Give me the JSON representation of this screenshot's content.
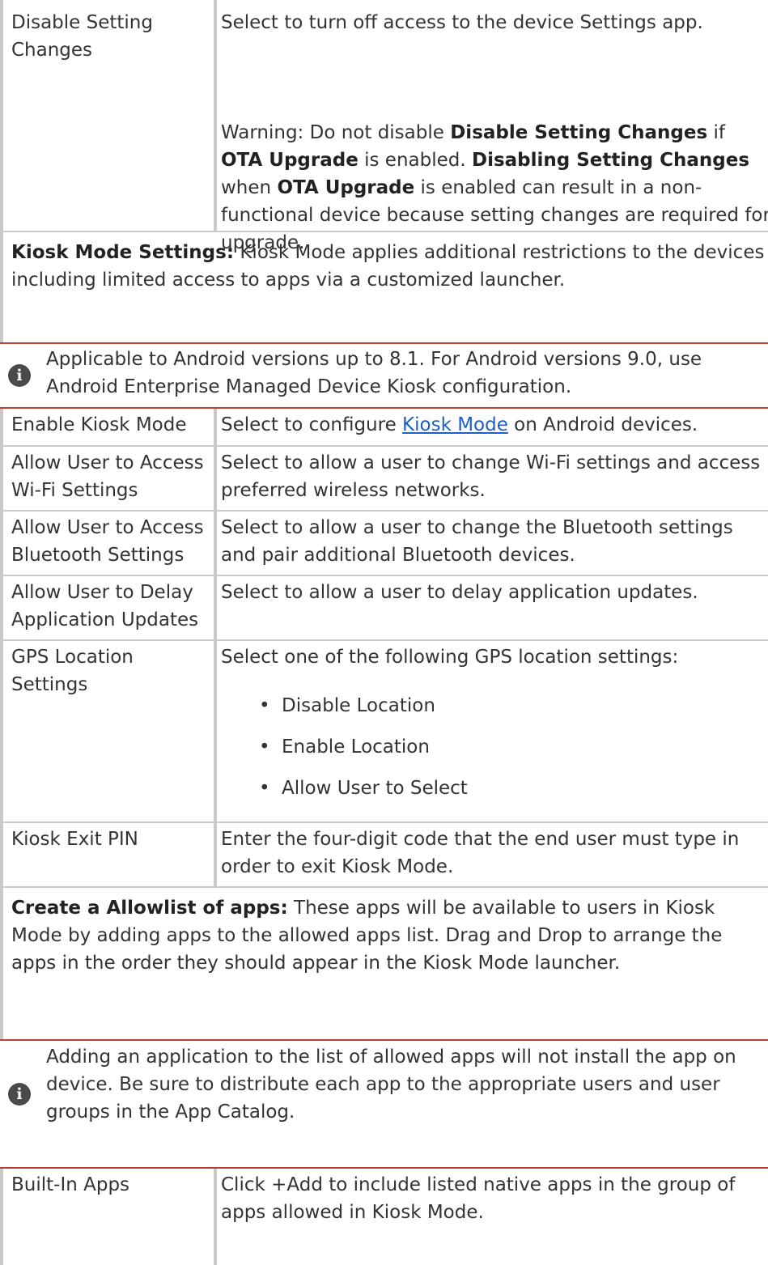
{
  "disable_setting": {
    "name": "Disable Setting Changes",
    "description": "Select to turn off access to the device Settings app.",
    "warning": {
      "prefix": "Warning: Do not disable ",
      "b1": "Disable Setting Changes",
      "t1": " if ",
      "b2": "OTA Upgrade",
      "t2": " is enabled. ",
      "b3": "Disabling Setting Changes",
      "t3": " when ",
      "b4": "OTA Upgrade",
      "t4": " is enabled can result in a non-functional device because setting changes are required for upgrade."
    }
  },
  "kiosk_section": {
    "heading": "Kiosk Mode Settings:",
    "text": " Kiosk Mode applies additional restrictions to the devices including limited access to apps via a customized launcher.",
    "note": "Applicable to Android versions up to 8.1. For Android versions 9.0, use Android Enterprise Managed Device Kiosk configuration."
  },
  "rows": {
    "enable_kiosk": {
      "name": "Enable Kiosk Mode",
      "desc_before": "Select to configure ",
      "link": "Kiosk Mode",
      "desc_after": " on Android devices."
    },
    "wifi": {
      "name": "Allow User to Access Wi-Fi Settings",
      "desc": "Select to allow a  user to change Wi-Fi settings and access preferred wireless networks."
    },
    "bluetooth": {
      "name": "Allow User to Access Bluetooth Settings",
      "desc": "Select to allow a user to change the Bluetooth settings and pair additional Bluetooth devices."
    },
    "delay_updates": {
      "name": "Allow User to Delay Application Updates",
      "desc": "Select to allow a user to delay application updates."
    },
    "gps": {
      "name": "GPS Location Settings",
      "desc": "Select one of the following GPS location settings:",
      "options": [
        "Disable Location",
        "Enable Location",
        "Allow User to Select"
      ]
    },
    "exit_pin": {
      "name": "Kiosk Exit PIN",
      "desc": "Enter the four-digit code that the end user must type in order to exit Kiosk Mode."
    }
  },
  "allowlist_section": {
    "heading": "Create a Allowlist of apps:",
    "text": " These apps will be available to users in Kiosk Mode by adding apps to the allowed apps list. Drag and Drop to arrange the apps in the order they should appear in the Kiosk Mode launcher.",
    "note": "Adding an application to the list of allowed apps will not install the app on device. Be sure to distribute each app to the appropriate users and user groups in the App Catalog."
  },
  "built_in": {
    "name": "Built-In Apps",
    "desc": "Click +Add to include listed native apps in the group of apps allowed in Kiosk Mode."
  },
  "icons": {
    "note": "info-icon",
    "bullet": "•"
  },
  "colors": {
    "link": "#1a5fcc",
    "separator": "#b9413a",
    "border": "#c9c9c9"
  }
}
